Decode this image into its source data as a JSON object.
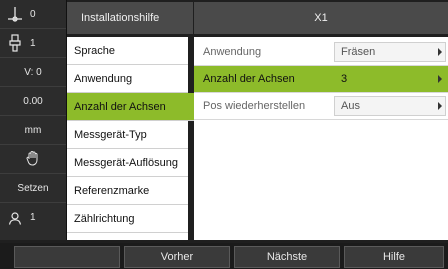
{
  "status_bar": {
    "items": [
      {
        "icon": "axis-origin-icon",
        "value": "0"
      },
      {
        "icon": "tool-icon",
        "value": "1"
      },
      {
        "icon": "",
        "value": "V: 0"
      },
      {
        "icon": "",
        "value": "0.00"
      },
      {
        "icon": "",
        "value": "mm"
      },
      {
        "icon": "hand-icon",
        "value": ""
      },
      {
        "icon": "",
        "value": "Setzen"
      },
      {
        "icon": "user-icon",
        "value": "1"
      }
    ]
  },
  "header": {
    "left_title": "Installationshilfe",
    "right_title": "X1"
  },
  "menu": {
    "items": [
      {
        "label": "Sprache"
      },
      {
        "label": "Anwendung"
      },
      {
        "label": "Anzahl der Achsen"
      },
      {
        "label": "Messgerät-Typ"
      },
      {
        "label": "Messgerät-Auflösung"
      },
      {
        "label": "Referenzmarke"
      },
      {
        "label": "Zählrichtung"
      }
    ],
    "active_index": 2
  },
  "settings": {
    "rows": [
      {
        "label": "Anwendung",
        "value": "Fräsen"
      },
      {
        "label": "Anzahl der Achsen",
        "value": "3"
      },
      {
        "label": "Pos wiederherstellen",
        "value": "Aus"
      }
    ],
    "active_index": 1
  },
  "softkeys": {
    "keys": [
      "",
      "Vorher",
      "Nächste",
      "Hilfe"
    ]
  },
  "colors": {
    "accent": "#8dbb2a",
    "header": "#4a4a4a",
    "background": "#1f1f1f"
  }
}
